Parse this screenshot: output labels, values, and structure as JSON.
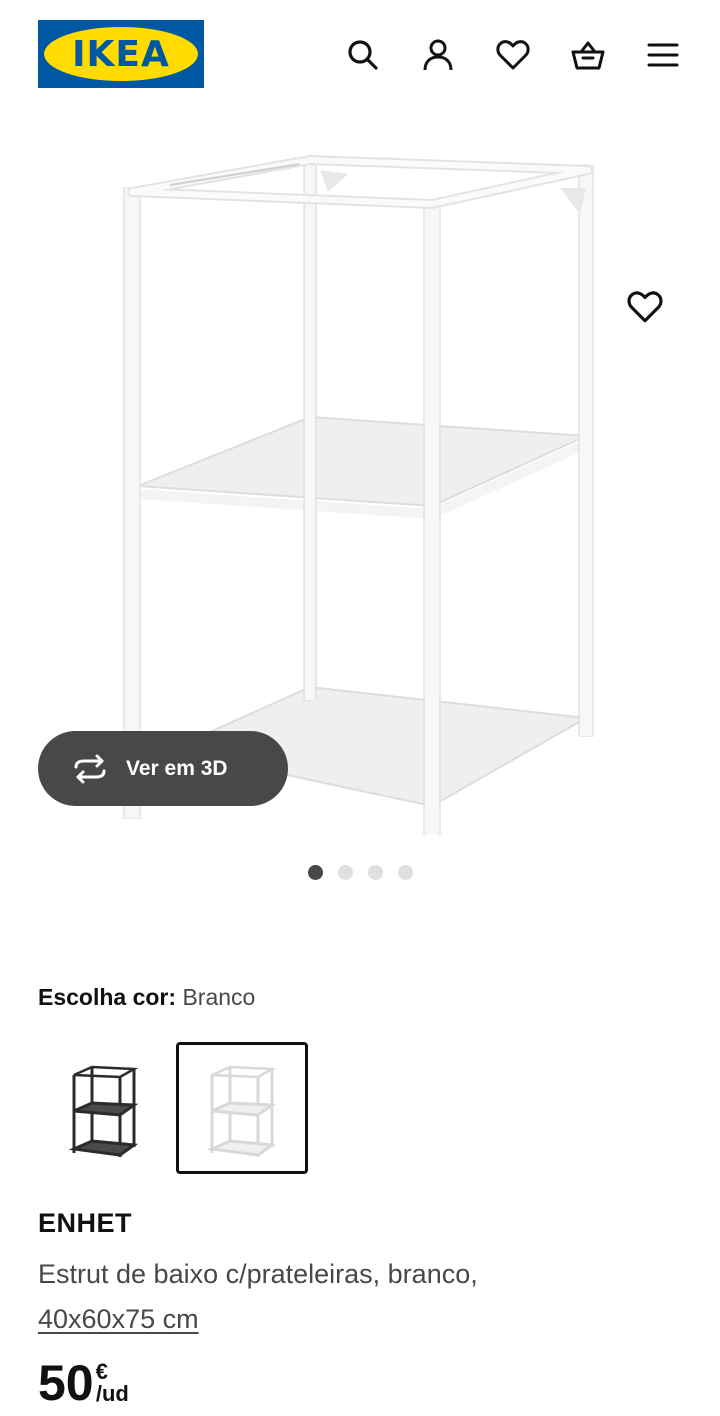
{
  "header": {
    "logo_text": "IKEA",
    "icons": [
      "search-icon",
      "user-icon",
      "heart-icon",
      "basket-icon",
      "menu-icon"
    ]
  },
  "gallery": {
    "view_3d_label": "Ver em 3D",
    "image_count": 4,
    "active_index": 0,
    "favorite_icon": "heart-icon"
  },
  "color_choice": {
    "label": "Escolha cor",
    "separator": ":",
    "selected_value": "Branco",
    "swatches": [
      "antracite",
      "Branco"
    ]
  },
  "product": {
    "name": "ENHET",
    "description": "Estrut de baixo c/prateleiras, branco,",
    "dimensions": "40x60x75 cm",
    "price_int": "50",
    "currency": "€",
    "unit": "/ud"
  },
  "colors": {
    "brand_blue": "#0058a3",
    "brand_yellow": "#ffdb00",
    "button_dark": "#484848",
    "text_primary": "#111111"
  }
}
